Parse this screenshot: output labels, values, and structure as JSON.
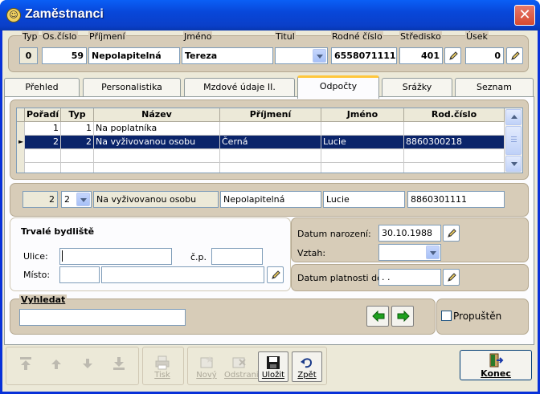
{
  "window": {
    "title": "Zaměstnanci",
    "close_glyph": "✕"
  },
  "header": {
    "labels": {
      "typ": "Typ",
      "os_cislo": "Os.číslo",
      "prijmeni": "Příjmení",
      "jmeno": "Jméno",
      "titul": "Titul",
      "rodne_cislo": "Rodné číslo",
      "stredisko": "Středisko",
      "usek": "Úsek"
    },
    "values": {
      "typ": "0",
      "os_cislo": "59",
      "prijmeni": "Nepolapitelná",
      "jmeno": "Tereza",
      "titul": "",
      "rodne_cislo": "6558071111",
      "stredisko": "401",
      "usek": "0"
    }
  },
  "tabs": [
    {
      "label": "Přehled",
      "active": false
    },
    {
      "label": "Personalistika",
      "active": false
    },
    {
      "label": "Mzdové údaje II.",
      "active": false
    },
    {
      "label": "Odpočty",
      "active": true
    },
    {
      "label": "Srážky",
      "active": false
    },
    {
      "label": "Seznam",
      "active": false
    }
  ],
  "grid": {
    "columns": [
      "Pořadí",
      "Typ",
      "Název",
      "Příjmení",
      "Jméno",
      "Rod.číslo"
    ],
    "rows": [
      {
        "poradi": "1",
        "typ": "1",
        "nazev": "Na poplatníka",
        "prijmeni": "",
        "jmeno": "",
        "rod_cislo": "",
        "selected": false,
        "indicator": ""
      },
      {
        "poradi": "2",
        "typ": "2",
        "nazev": "Na vyživovanou osobu",
        "prijmeni": "Černá",
        "jmeno": "Lucie",
        "rod_cislo": "8860300218",
        "selected": true,
        "indicator": "►"
      }
    ]
  },
  "detail": {
    "poradi": "2",
    "typ": "2",
    "nazev": "Na vyživovanou osobu",
    "prijmeni": "Nepolapitelná",
    "jmeno": "Lucie",
    "rod_cislo": "8860301111"
  },
  "address": {
    "title": "Trvalé bydliště",
    "ulice_label": "Ulice:",
    "ulice": "",
    "cp_label": "č.p.",
    "cp": "",
    "misto_label": "Místo:",
    "psc": "",
    "misto": ""
  },
  "dates": {
    "narozeni_label": "Datum narození:",
    "narozeni": "30.10.1988",
    "vztah_label": "Vztah:",
    "vztah": "",
    "platnost_label": "Datum platnosti do:",
    "platnost": " .  ."
  },
  "search": {
    "title": "Vyhledat",
    "value": "",
    "propusten_label": "Propuštěn",
    "propusten_checked": false
  },
  "toolbar": {
    "tisk": "Tisk",
    "novy": "Nový",
    "odstranit": "Odstranit",
    "ulozit": "Uložit",
    "zpet": "Zpět",
    "konec": "Konec"
  },
  "colors": {
    "title_bar": "#0a4fe0",
    "selection": "#0a246a",
    "panel": "#d7ccb8",
    "active_tab_accent": "#ffc73c",
    "arrow_green": "#1ea01e"
  }
}
